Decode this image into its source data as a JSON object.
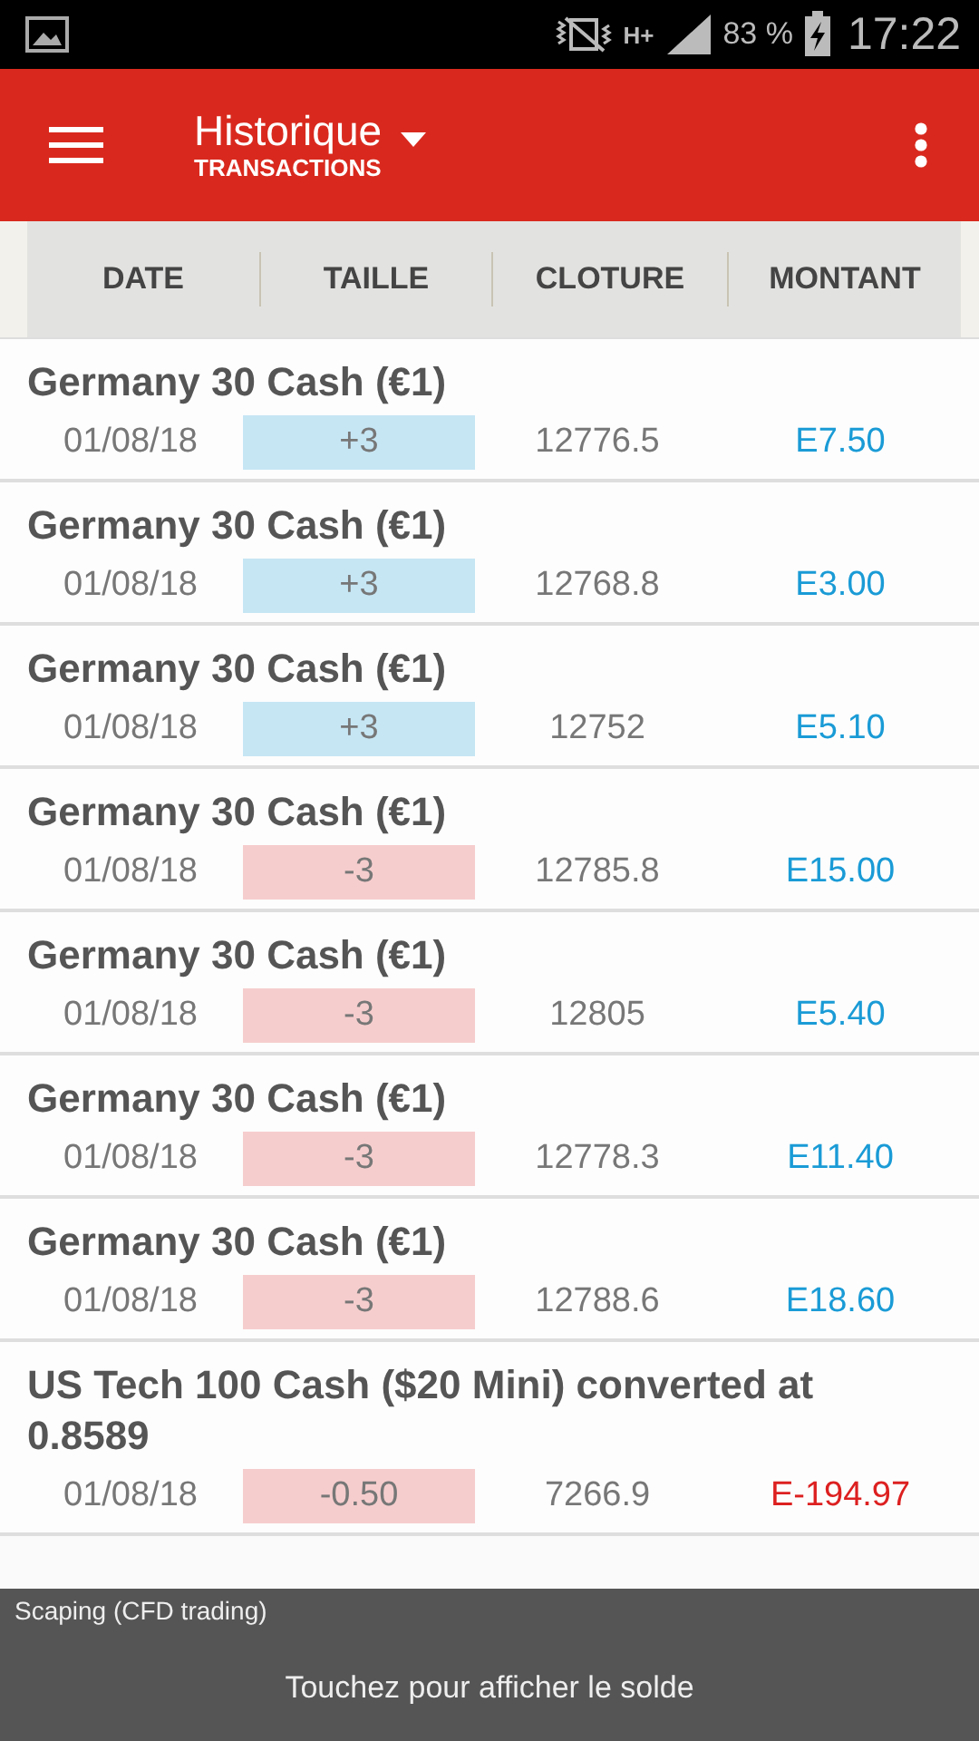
{
  "status_bar": {
    "network": "H+",
    "battery": "83 %",
    "time": "17:22"
  },
  "app_bar": {
    "title": "Historique",
    "subtitle": "TRANSACTIONS"
  },
  "table": {
    "columns": [
      "DATE",
      "TAILLE",
      "CLOTURE",
      "MONTANT"
    ],
    "rows": [
      {
        "name": "Germany 30 Cash (€1)",
        "date": "01/08/18",
        "size": "+3",
        "buy": true,
        "close": "12776.5",
        "amount": "E7.50",
        "loss": false
      },
      {
        "name": "Germany 30 Cash (€1)",
        "date": "01/08/18",
        "size": "+3",
        "buy": true,
        "close": "12768.8",
        "amount": "E3.00",
        "loss": false
      },
      {
        "name": "Germany 30 Cash (€1)",
        "date": "01/08/18",
        "size": "+3",
        "buy": true,
        "close": "12752",
        "amount": "E5.10",
        "loss": false
      },
      {
        "name": "Germany 30 Cash (€1)",
        "date": "01/08/18",
        "size": "-3",
        "buy": false,
        "close": "12785.8",
        "amount": "E15.00",
        "loss": false
      },
      {
        "name": "Germany 30 Cash (€1)",
        "date": "01/08/18",
        "size": "-3",
        "buy": false,
        "close": "12805",
        "amount": "E5.40",
        "loss": false
      },
      {
        "name": "Germany 30 Cash (€1)",
        "date": "01/08/18",
        "size": "-3",
        "buy": false,
        "close": "12778.3",
        "amount": "E11.40",
        "loss": false
      },
      {
        "name": "Germany 30 Cash (€1)",
        "date": "01/08/18",
        "size": "-3",
        "buy": false,
        "close": "12788.6",
        "amount": "E18.60",
        "loss": false
      },
      {
        "name": "US Tech 100 Cash ($20 Mini) converted at 0.8589",
        "date": "01/08/18",
        "size": "-0.50",
        "buy": false,
        "close": "7266.9",
        "amount": "E-194.97",
        "loss": true
      }
    ]
  },
  "footer": {
    "account": "Scaping (CFD trading)",
    "action": "Touchez pour afficher le solde"
  }
}
